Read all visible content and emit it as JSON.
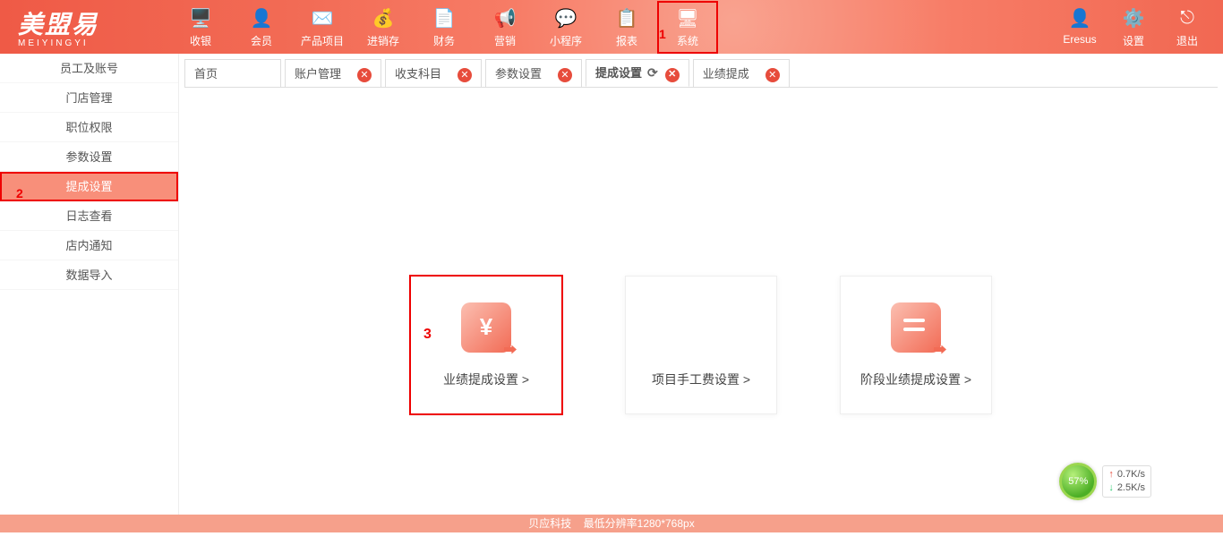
{
  "logo": {
    "text": "美盟易",
    "sub": "MEIYINGYI"
  },
  "nav": [
    {
      "label": "收银",
      "icon": "cash-register-icon"
    },
    {
      "label": "会员",
      "icon": "member-icon"
    },
    {
      "label": "产品项目",
      "icon": "product-icon"
    },
    {
      "label": "进销存",
      "icon": "inventory-icon"
    },
    {
      "label": "财务",
      "icon": "finance-icon"
    },
    {
      "label": "营销",
      "icon": "marketing-icon"
    },
    {
      "label": "小程序",
      "icon": "wechat-icon"
    },
    {
      "label": "报表",
      "icon": "report-icon"
    },
    {
      "label": "系统",
      "icon": "system-icon",
      "highlight": true,
      "num": "1"
    }
  ],
  "header_right": [
    {
      "label": "Eresus",
      "icon": "user-icon"
    },
    {
      "label": "设置",
      "icon": "settings-icon"
    },
    {
      "label": "退出",
      "icon": "logout-icon"
    }
  ],
  "sidebar": [
    {
      "label": "员工及账号"
    },
    {
      "label": "门店管理"
    },
    {
      "label": "职位权限"
    },
    {
      "label": "参数设置"
    },
    {
      "label": "提成设置",
      "active": true,
      "num": "2"
    },
    {
      "label": "日志查看"
    },
    {
      "label": "店内通知"
    },
    {
      "label": "数据导入"
    }
  ],
  "tabs": [
    {
      "label": "首页",
      "closable": false
    },
    {
      "label": "账户管理",
      "closable": true
    },
    {
      "label": "收支科目",
      "closable": true
    },
    {
      "label": "参数设置",
      "closable": true
    },
    {
      "label": "提成设置",
      "closable": true,
      "active": true,
      "refresh": true
    },
    {
      "label": "业绩提成",
      "closable": true
    }
  ],
  "cards": [
    {
      "label": "业绩提成设置 >",
      "icon": "yen",
      "highlight": true,
      "num": "3"
    },
    {
      "label": "项目手工费设置 >",
      "icon": "grid"
    },
    {
      "label": "阶段业绩提成设置 >",
      "icon": "doc"
    }
  ],
  "footer": {
    "company": "贝应科技",
    "res": "最低分辨率1280*768px"
  },
  "net": {
    "pct": "57%",
    "up": "0.7K/s",
    "dn": "2.5K/s"
  }
}
